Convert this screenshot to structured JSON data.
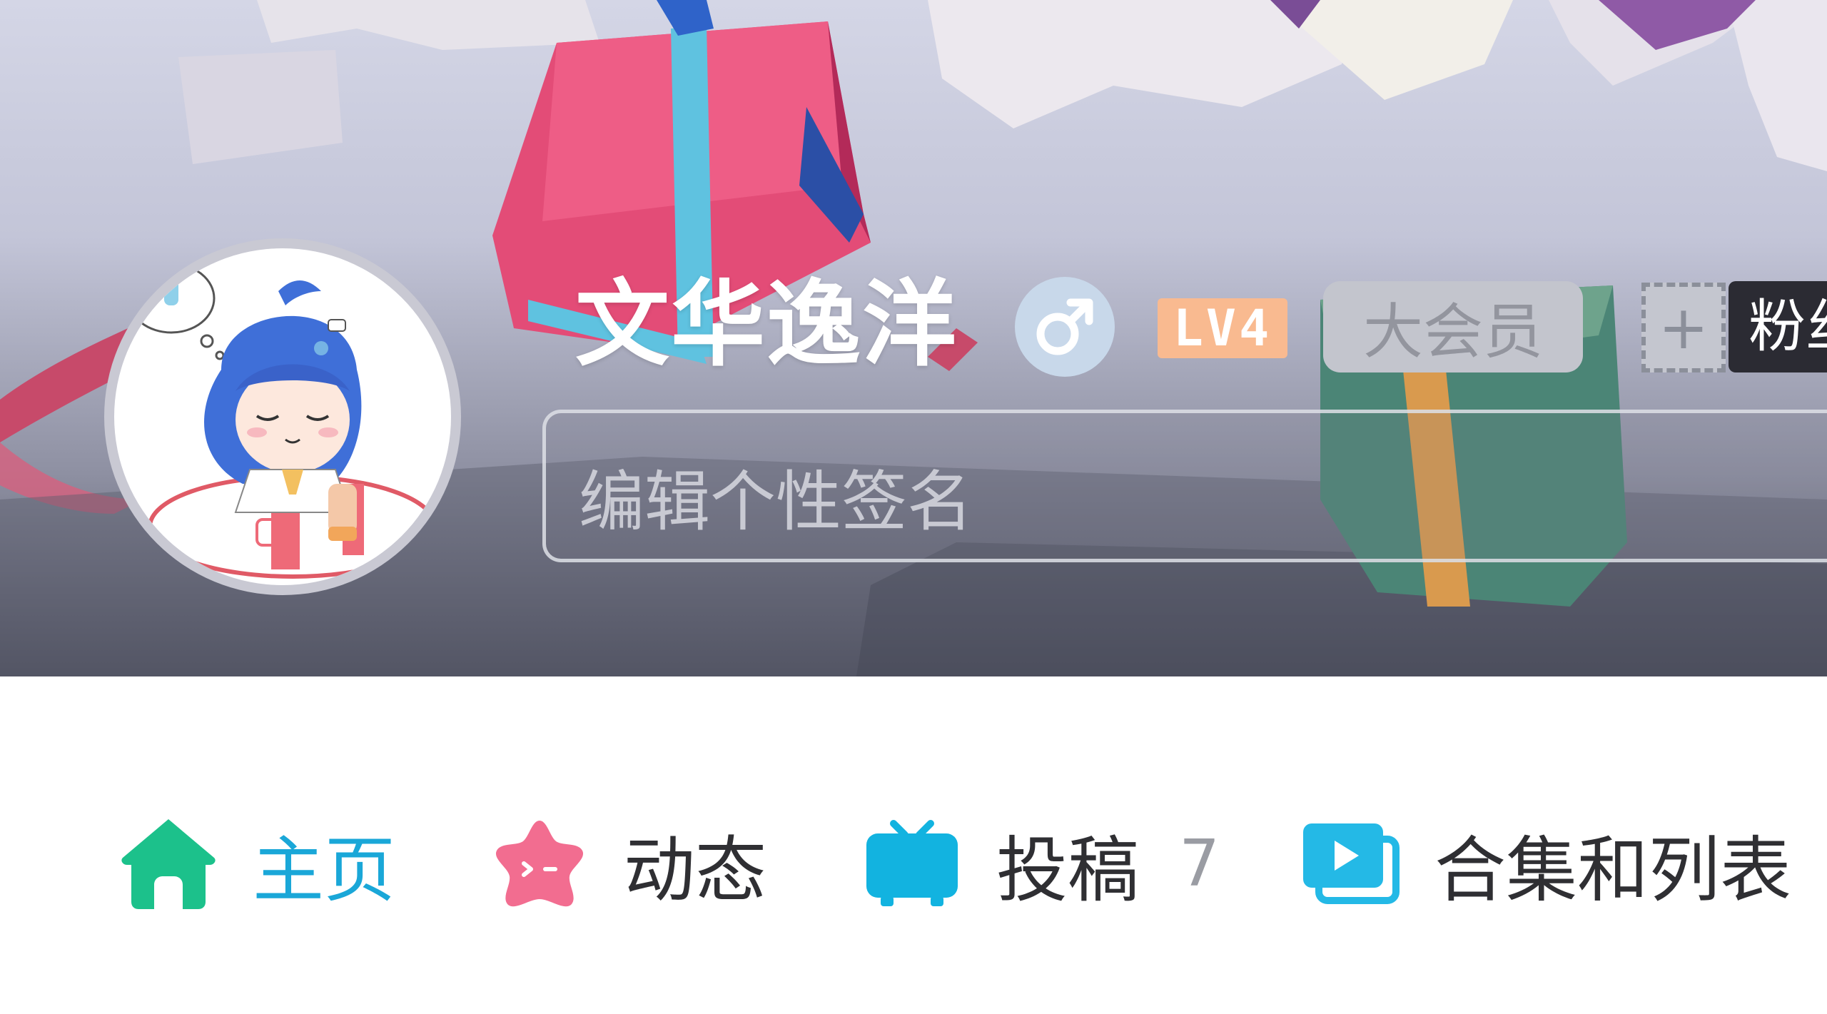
{
  "profile": {
    "username": "文华逸洋",
    "gender_symbol": "♂",
    "level": "LV4",
    "vip_label": "大会员",
    "add_medal_label": "+",
    "fan_tag_label": "粉丝",
    "signature_placeholder": "编辑个性签名"
  },
  "tabs": [
    {
      "label": "主页",
      "icon": "home-icon",
      "active": true
    },
    {
      "label": "动态",
      "icon": "dynamic-star-icon",
      "active": false
    },
    {
      "label": "投稿",
      "icon": "tv-icon",
      "count": "7",
      "active": false
    },
    {
      "label": "合集和列表",
      "icon": "playlist-icon",
      "active": false
    }
  ],
  "colors": {
    "active_tab_text": "#1aa7d8",
    "home_icon": "#1cc18b",
    "dynamic_icon": "#f26d90",
    "tv_icon": "#12b3e0",
    "playlist_icon": "#24b9e6",
    "level_badge": "#f9ba90",
    "gender_badge": "#c8d8ea"
  }
}
